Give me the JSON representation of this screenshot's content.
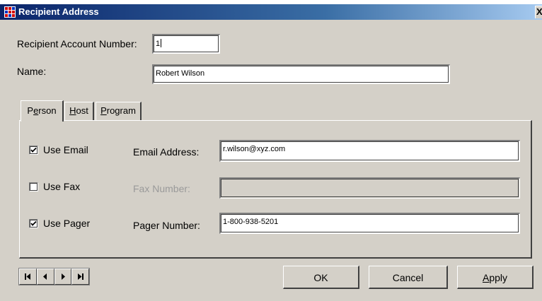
{
  "window": {
    "title": "Recipient Address",
    "close_glyph": "X"
  },
  "form": {
    "account_number_label": "Recipient Account Number:",
    "account_number_value": "1",
    "name_label": "Name:",
    "name_value": "Robert Wilson"
  },
  "tabs": [
    {
      "label_pre": "P",
      "label_accel": "e",
      "label_post": "rson",
      "active": true
    },
    {
      "label_pre": "",
      "label_accel": "H",
      "label_post": "ost",
      "active": false
    },
    {
      "label_pre": "",
      "label_accel": "P",
      "label_post": "rogram",
      "active": false
    }
  ],
  "person": {
    "use_email_label": "Use Email",
    "use_email_checked": true,
    "email_label": "Email Address:",
    "email_value": "r.wilson@xyz.com",
    "use_fax_label": "Use Fax",
    "use_fax_checked": false,
    "fax_label": "Fax Number:",
    "fax_value": "",
    "use_pager_label": "Use Pager",
    "use_pager_checked": true,
    "pager_label": "Pager Number:",
    "pager_value": "1-800-938-5201"
  },
  "navigation": {
    "first_icon": "first-record-icon",
    "prev_icon": "previous-record-icon",
    "next_icon": "next-record-icon",
    "last_icon": "last-record-icon"
  },
  "buttons": {
    "ok_label": "OK",
    "cancel_label": "Cancel",
    "apply_accel": "A",
    "apply_rest": "pply"
  },
  "colors": {
    "titlebar_start": "#0a246a",
    "titlebar_end": "#a6caf0",
    "face": "#d4d0c8",
    "disabled_text": "#9a9a9a"
  }
}
